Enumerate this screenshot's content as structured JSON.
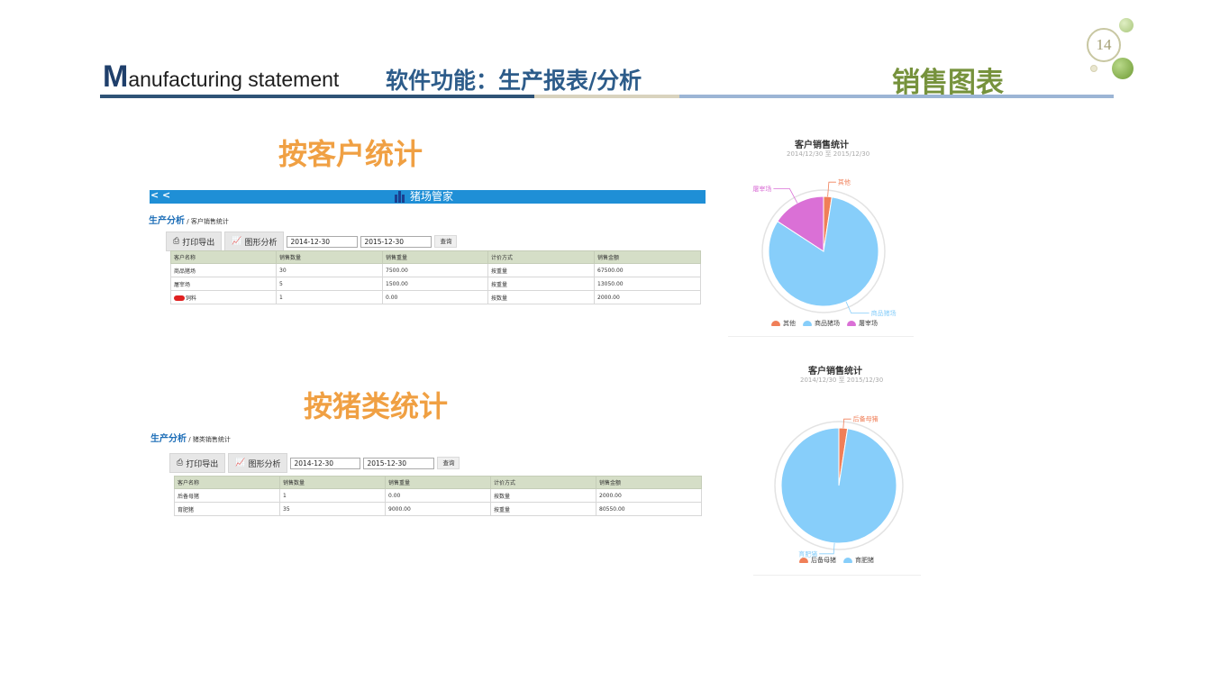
{
  "slide": {
    "title_en_initial": "M",
    "title_en_rest": "anufacturing statement",
    "title_cn": "软件功能：生产报表/分析",
    "title_right": "销售图表",
    "page_number": "14"
  },
  "section1": {
    "heading": "按客户统计",
    "app_back": "< <",
    "app_logo_text": "猪场管家",
    "breadcrumb_main": "生产分析",
    "breadcrumb_sep": "/",
    "breadcrumb_sub": "客户销售统计",
    "print_label": "打印导出",
    "chart_label": "图形分析",
    "date_from": "2014-12-30",
    "date_to": "2015-12-30",
    "query_label": "查询",
    "columns": [
      "客户名称",
      "销售数量",
      "销售重量",
      "计价方式",
      "销售金额"
    ],
    "rows": [
      [
        "商品猪场",
        "30",
        "7500.00",
        "按重量",
        "67500.00"
      ],
      [
        "屠宰场",
        "5",
        "1500.00",
        "按重量",
        "13050.00"
      ],
      [
        "饲料",
        "1",
        "0.00",
        "按数量",
        "2000.00"
      ]
    ]
  },
  "section2": {
    "heading": "按猪类统计",
    "breadcrumb_main": "生产分析",
    "breadcrumb_sep": "/",
    "breadcrumb_sub": "猪类销售统计",
    "print_label": "打印导出",
    "chart_label": "图形分析",
    "date_from": "2014-12-30",
    "date_to": "2015-12-30",
    "query_label": "查询",
    "columns": [
      "客户名称",
      "销售数量",
      "销售重量",
      "计价方式",
      "销售金额"
    ],
    "rows": [
      [
        "后备母猪",
        "1",
        "0.00",
        "按数量",
        "2000.00"
      ],
      [
        "育肥猪",
        "35",
        "9000.00",
        "按重量",
        "80550.00"
      ]
    ]
  },
  "icons": {
    "print": "printer-icon",
    "chart": "line-chart-icon"
  },
  "chart_data": [
    {
      "type": "pie",
      "title": "客户销售统计",
      "subtitle": "2014/12/30 至 2015/12/30",
      "categories": [
        "其他",
        "商品猪场",
        "屠宰场"
      ],
      "values": [
        2000,
        67500,
        13050
      ],
      "colors": [
        "#f07f58",
        "#87cefa",
        "#da70d6"
      ],
      "legend_position": "bottom"
    },
    {
      "type": "pie",
      "title": "客户销售统计",
      "subtitle": "2014/12/30 至 2015/12/30",
      "categories": [
        "后备母猪",
        "育肥猪"
      ],
      "values": [
        2000,
        80550
      ],
      "colors": [
        "#f07f58",
        "#87cefa"
      ],
      "legend_position": "bottom"
    }
  ]
}
